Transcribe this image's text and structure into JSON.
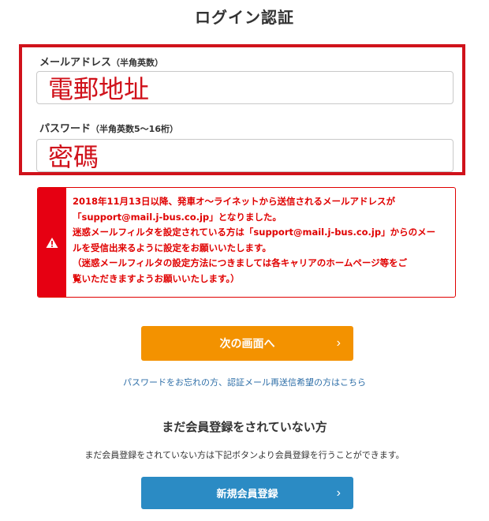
{
  "page": {
    "title": "ログイン認証"
  },
  "form": {
    "email": {
      "label": "メールアドレス",
      "note": "（半角英数）",
      "value": "電郵地址"
    },
    "password": {
      "label": "パスワード",
      "note": "（半角英数5〜16桁）",
      "value": "密碼"
    },
    "highlight_color": "#d0121b"
  },
  "notice": {
    "icon": "warning-icon",
    "accent_color": "#e60012",
    "lines": [
      "2018年11月13日以降、発車オ～ライネットから送信されるメールアドレスが",
      "「support@mail.j-bus.co.jp」となりました。",
      "迷惑メールフィルタを設定されている方は「support@mail.j-bus.co.jp」からのメー",
      "ルを受信出来るように設定をお願いいたします。",
      "（迷惑メールフィルタの設定方法につきましては各キャリアのホームページ等をご",
      "覧いただきますようお願いいたします。）"
    ]
  },
  "actions": {
    "next_label": "次の画面へ",
    "next_color": "#f39200",
    "forgot_link": "パスワードをお忘れの方、認証メール再送信希望の方はこちら"
  },
  "register": {
    "heading": "まだ会員登録をされていない方",
    "description": "まだ会員登録をされていない方は下記ボタンより会員登録を行うことができます。",
    "button_label": "新規会員登録",
    "button_color": "#2b8bc4"
  }
}
